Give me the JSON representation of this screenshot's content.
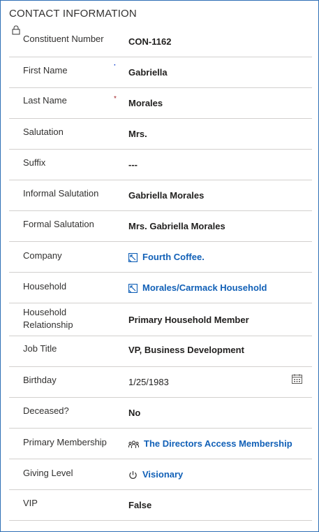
{
  "section": {
    "title": "CONTACT INFORMATION"
  },
  "fields": {
    "constituent_number": {
      "label": "Constituent Number",
      "value": "CON-1162",
      "locked": true
    },
    "first_name": {
      "label": "First Name",
      "value": "Gabriella"
    },
    "last_name": {
      "label": "Last Name",
      "required_marker": "*",
      "value": "Morales"
    },
    "salutation": {
      "label": "Salutation",
      "value": "Mrs."
    },
    "suffix": {
      "label": "Suffix",
      "value": "---"
    },
    "informal_salutation": {
      "label": "Informal Salutation",
      "value": "Gabriella Morales"
    },
    "formal_salutation": {
      "label": "Formal Salutation",
      "value": "Mrs. Gabriella Morales"
    },
    "company": {
      "label": "Company",
      "value": "Fourth Coffee.",
      "icon": "record-link-icon"
    },
    "household": {
      "label": "Household",
      "value": "Morales/Carmack Household",
      "icon": "record-link-icon"
    },
    "household_relationship": {
      "label_line1": "Household",
      "label_line2": "Relationship",
      "value": "Primary Household Member"
    },
    "job_title": {
      "label": "Job Title",
      "value": "VP, Business Development"
    },
    "birthday": {
      "label": "Birthday",
      "value": "1/25/1983",
      "icon": "calendar-icon"
    },
    "deceased": {
      "label": "Deceased?",
      "value": "No"
    },
    "primary_membership": {
      "label": "Primary Membership",
      "value": "The Directors Access Membership",
      "icon": "people-group-icon"
    },
    "giving_level": {
      "label": "Giving Level",
      "value": "Visionary",
      "icon": "power-icon"
    },
    "vip": {
      "label": "VIP",
      "value": "False"
    }
  },
  "colors": {
    "link": "#1160b7",
    "border": "#2f6fb5",
    "divider": "#d2d0ce",
    "required": "#a4262c"
  }
}
